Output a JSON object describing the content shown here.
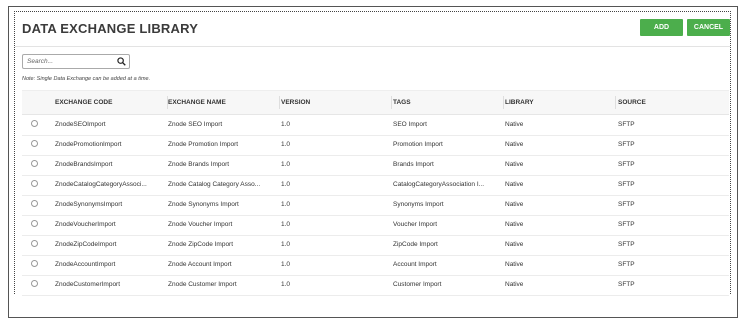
{
  "dialog": {
    "title": "DATA EXCHANGE LIBRARY",
    "add_label": "ADD",
    "cancel_label": "CANCEL"
  },
  "search": {
    "placeholder": "Search..."
  },
  "note": "Note: Single Data Exchange can be added at a time.",
  "table": {
    "headers": [
      "EXCHANGE CODE",
      "EXCHANGE NAME",
      "VERSION",
      "TAGS",
      "LIBRARY",
      "SOURCE"
    ],
    "rows": [
      [
        "ZnodeSEOImport",
        "Znode SEO Import",
        "1.0",
        "SEO Import",
        "Native",
        "SFTP"
      ],
      [
        "ZnodePromotionImport",
        "Znode Promotion Import",
        "1.0",
        "Promotion Import",
        "Native",
        "SFTP"
      ],
      [
        "ZnodeBrandsImport",
        "Znode Brands Import",
        "1.0",
        "Brands Import",
        "Native",
        "SFTP"
      ],
      [
        "ZnodeCatalogCategoryAssoci...",
        "Znode Catalog Category Asso...",
        "1.0",
        "CatalogCategoryAssociation I...",
        "Native",
        "SFTP"
      ],
      [
        "ZnodeSynonymsImport",
        "Znode Synonyms Import",
        "1.0",
        "Synonyms Import",
        "Native",
        "SFTP"
      ],
      [
        "ZnodeVoucherImport",
        "Znode Voucher Import",
        "1.0",
        "Voucher Import",
        "Native",
        "SFTP"
      ],
      [
        "ZnodeZipCodeImport",
        "Znode ZipCode Import",
        "1.0",
        "ZipCode Import",
        "Native",
        "SFTP"
      ],
      [
        "ZnodeAccountImport",
        "Znode Account Import",
        "1.0",
        "Account Import",
        "Native",
        "SFTP"
      ],
      [
        "ZnodeCustomerImport",
        "Znode Customer Import",
        "1.0",
        "Customer Import",
        "Native",
        "SFTP"
      ]
    ]
  },
  "colors": {
    "button_green": "#4cae4c",
    "border": "#555555"
  },
  "icons": {
    "search": "search-icon",
    "radio": "radio-icon"
  }
}
